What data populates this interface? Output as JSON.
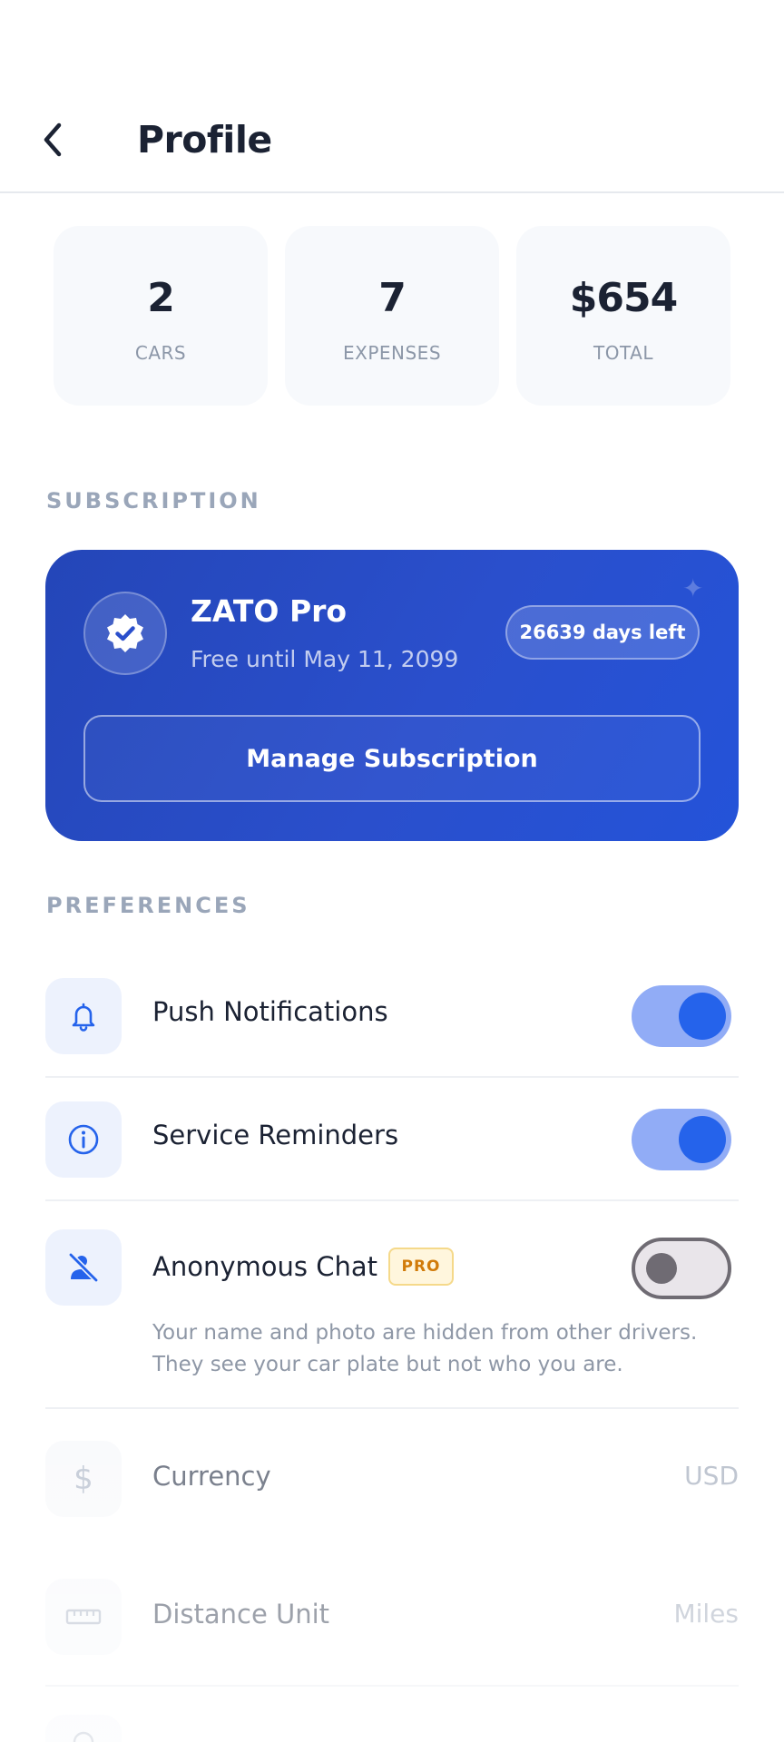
{
  "header": {
    "title": "Profile",
    "back_icon": "chevron-left-icon"
  },
  "stats": [
    {
      "value": "2",
      "label": "CARS"
    },
    {
      "value": "7",
      "label": "EXPENSES"
    },
    {
      "value": "$654",
      "label": "TOTAL"
    }
  ],
  "subscription": {
    "section_label": "SUBSCRIPTION",
    "plan_name": "ZATO Pro",
    "plan_status": "Free until May 11, 2099",
    "days_left": "26639 days left",
    "manage_label": "Manage Subscription",
    "icon": "verified-badge-icon",
    "card_color": "#2a4fcc"
  },
  "preferences": {
    "section_label": "PREFERENCES",
    "push_notifications": {
      "label": "Push Notifications",
      "enabled": true,
      "icon": "bell-icon"
    },
    "service_reminders": {
      "label": "Service Reminders",
      "enabled": true,
      "icon": "info-icon"
    },
    "anonymous_chat": {
      "label": "Anonymous Chat",
      "badge": "PRO",
      "enabled": false,
      "icon": "user-off-icon",
      "description": "Your name and photo are hidden from other drivers. They see your car plate but not who you are."
    },
    "currency": {
      "label": "Currency",
      "value": "USD",
      "icon": "dollar-icon"
    },
    "distance_unit": {
      "label": "Distance Unit",
      "value": "Miles",
      "icon": "ruler-icon"
    }
  },
  "colors": {
    "accent": "#2563eb",
    "toggle_track_on": "#91acf6",
    "pro_badge": "#d17b0a"
  }
}
